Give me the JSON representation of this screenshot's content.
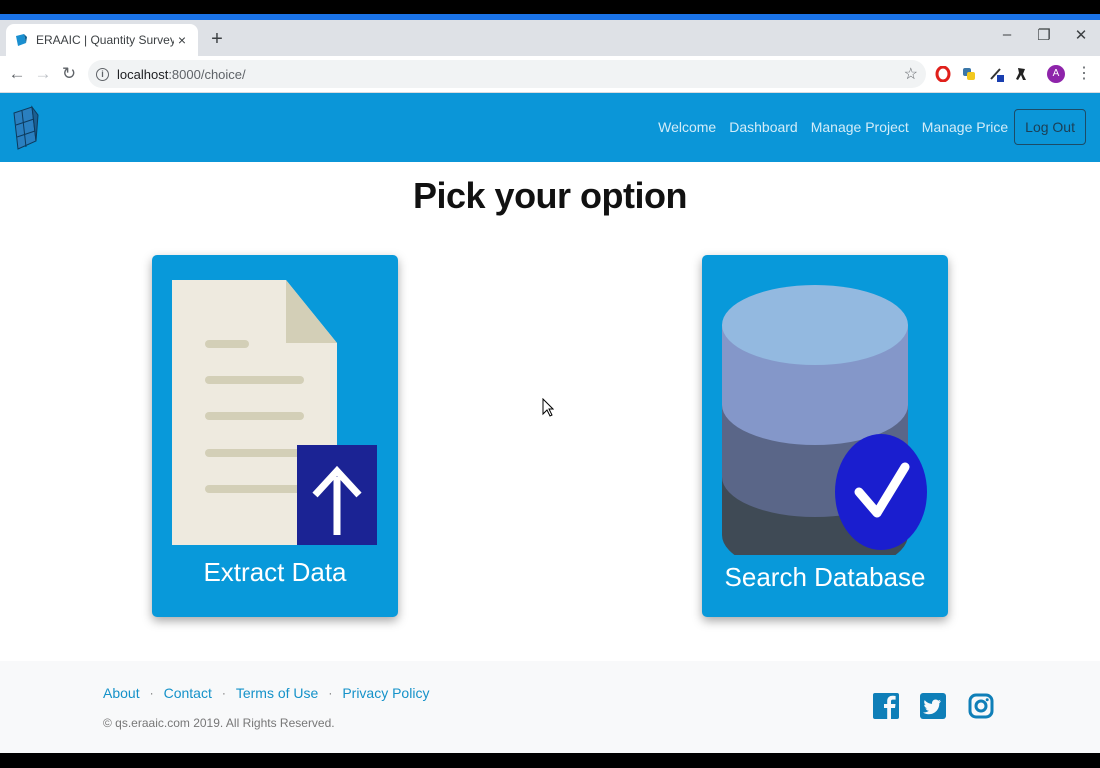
{
  "browser": {
    "tab_title": "ERAAIC | Quantity Survey",
    "tab_close": "×",
    "new_tab": "+",
    "window_controls": {
      "minimize": "–",
      "restore": "❐",
      "close": "✕"
    },
    "url_host": "localhost",
    "url_rest": ":8000/choice/",
    "avatar_letter": "A"
  },
  "navbar": {
    "links": [
      "Welcome",
      "Dashboard",
      "Manage Project",
      "Manage Price"
    ],
    "logout_label": "Log Out",
    "color": "#0b96d8"
  },
  "main": {
    "heading": "Pick your option",
    "cards": [
      {
        "label": "Extract Data",
        "icon": "document-upload-icon"
      },
      {
        "label": "Search Database",
        "icon": "database-check-icon"
      }
    ]
  },
  "footer": {
    "links": [
      "About",
      "Contact",
      "Terms of Use",
      "Privacy Policy"
    ],
    "separator": "·",
    "copyright": "© qs.eraaic.com 2019. All Rights Reserved.",
    "social": [
      "facebook-icon",
      "twitter-icon",
      "instagram-icon"
    ],
    "social_color": "#0f7fb8"
  }
}
